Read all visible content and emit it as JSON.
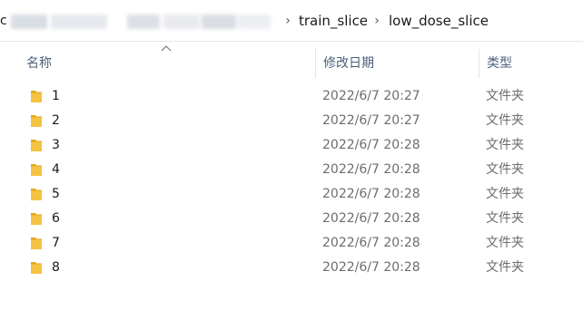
{
  "breadcrumb": {
    "prefix": "c",
    "items": [
      {
        "label": "train_slice"
      },
      {
        "label": "low_dose_slice"
      }
    ],
    "separator": "›"
  },
  "columns": {
    "name": "名称",
    "date": "修改日期",
    "type": "类型",
    "sort_indicator": "^"
  },
  "colors": {
    "folder": "#f5c242",
    "folder_dark": "#e3a81e",
    "header_text": "#4c607a",
    "secondary_text": "#6d6d6d"
  },
  "rows": [
    {
      "name": "1",
      "date": "2022/6/7 20:27",
      "type": "文件夹",
      "icon": "folder-icon"
    },
    {
      "name": "2",
      "date": "2022/6/7 20:27",
      "type": "文件夹",
      "icon": "folder-icon"
    },
    {
      "name": "3",
      "date": "2022/6/7 20:28",
      "type": "文件夹",
      "icon": "folder-icon"
    },
    {
      "name": "4",
      "date": "2022/6/7 20:28",
      "type": "文件夹",
      "icon": "folder-icon"
    },
    {
      "name": "5",
      "date": "2022/6/7 20:28",
      "type": "文件夹",
      "icon": "folder-icon"
    },
    {
      "name": "6",
      "date": "2022/6/7 20:28",
      "type": "文件夹",
      "icon": "folder-icon"
    },
    {
      "name": "7",
      "date": "2022/6/7 20:28",
      "type": "文件夹",
      "icon": "folder-icon"
    },
    {
      "name": "8",
      "date": "2022/6/7 20:28",
      "type": "文件夹",
      "icon": "folder-icon"
    }
  ]
}
